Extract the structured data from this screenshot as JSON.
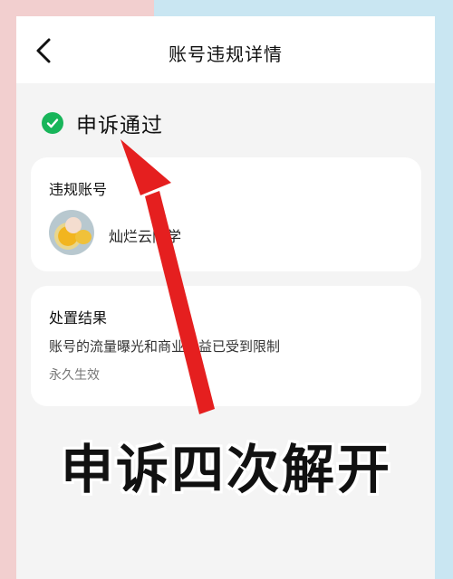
{
  "header": {
    "title": "账号违规详情"
  },
  "status": {
    "text": "申诉通过",
    "color": "#18b55a"
  },
  "violation_card": {
    "title": "违规账号",
    "username": "灿烂云同学"
  },
  "result_card": {
    "title": "处置结果",
    "description": "账号的流量曝光和商业权益已受到限制",
    "duration": "永久生效"
  },
  "overlay": {
    "caption": "申诉四次解开",
    "arrow_color": "#e51f1f"
  },
  "icons": {
    "back": "chevron-left-icon",
    "status": "check-circle-icon"
  }
}
